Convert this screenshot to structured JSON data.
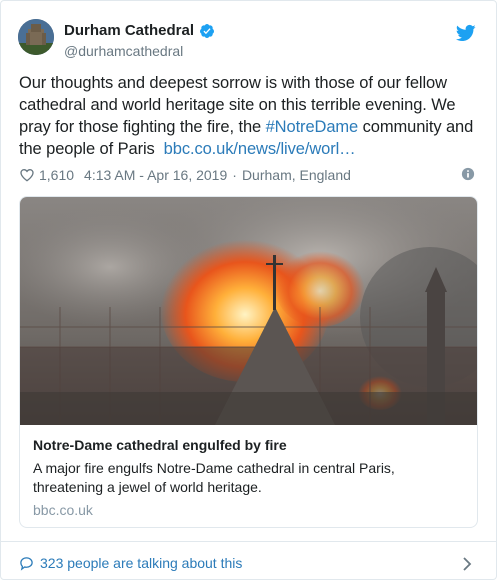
{
  "author": {
    "name": "Durham Cathedral",
    "handle": "@durhamcathedral"
  },
  "tweet": {
    "text_line1": "Our thoughts and deepest sorrow is with those of our fellow",
    "text_line2": "cathedral and world heritage site on this terrible evening. We",
    "text_line3_a": "pray for those fighting the fire, the ",
    "hashtag": "#NotreDame",
    "text_line3_b": " community and",
    "text_line4": "the people of Paris  ",
    "link": "bbc.co.uk/news/live/worl…"
  },
  "meta": {
    "likes": "1,610",
    "timestamp": "4:13 AM - Apr 16, 2019",
    "separator": "·",
    "location": "Durham, England"
  },
  "link_card": {
    "title": "Notre-Dame cathedral engulfed by fire",
    "description": "A major fire engulfs Notre-Dame cathedral in central Paris, threatening a jewel of world heritage.",
    "domain": "bbc.co.uk"
  },
  "footer": {
    "talking": "323 people are talking about this"
  },
  "colors": {
    "link": "#2b7bb9",
    "twitter_blue": "#1da1f2",
    "secondary": "#697882"
  },
  "icons": {
    "verified": "verified-badge-icon",
    "bird": "twitter-bird-icon",
    "heart": "heart-icon",
    "info": "info-icon",
    "comment": "comment-bubble-icon",
    "chevron": "chevron-right-icon"
  }
}
